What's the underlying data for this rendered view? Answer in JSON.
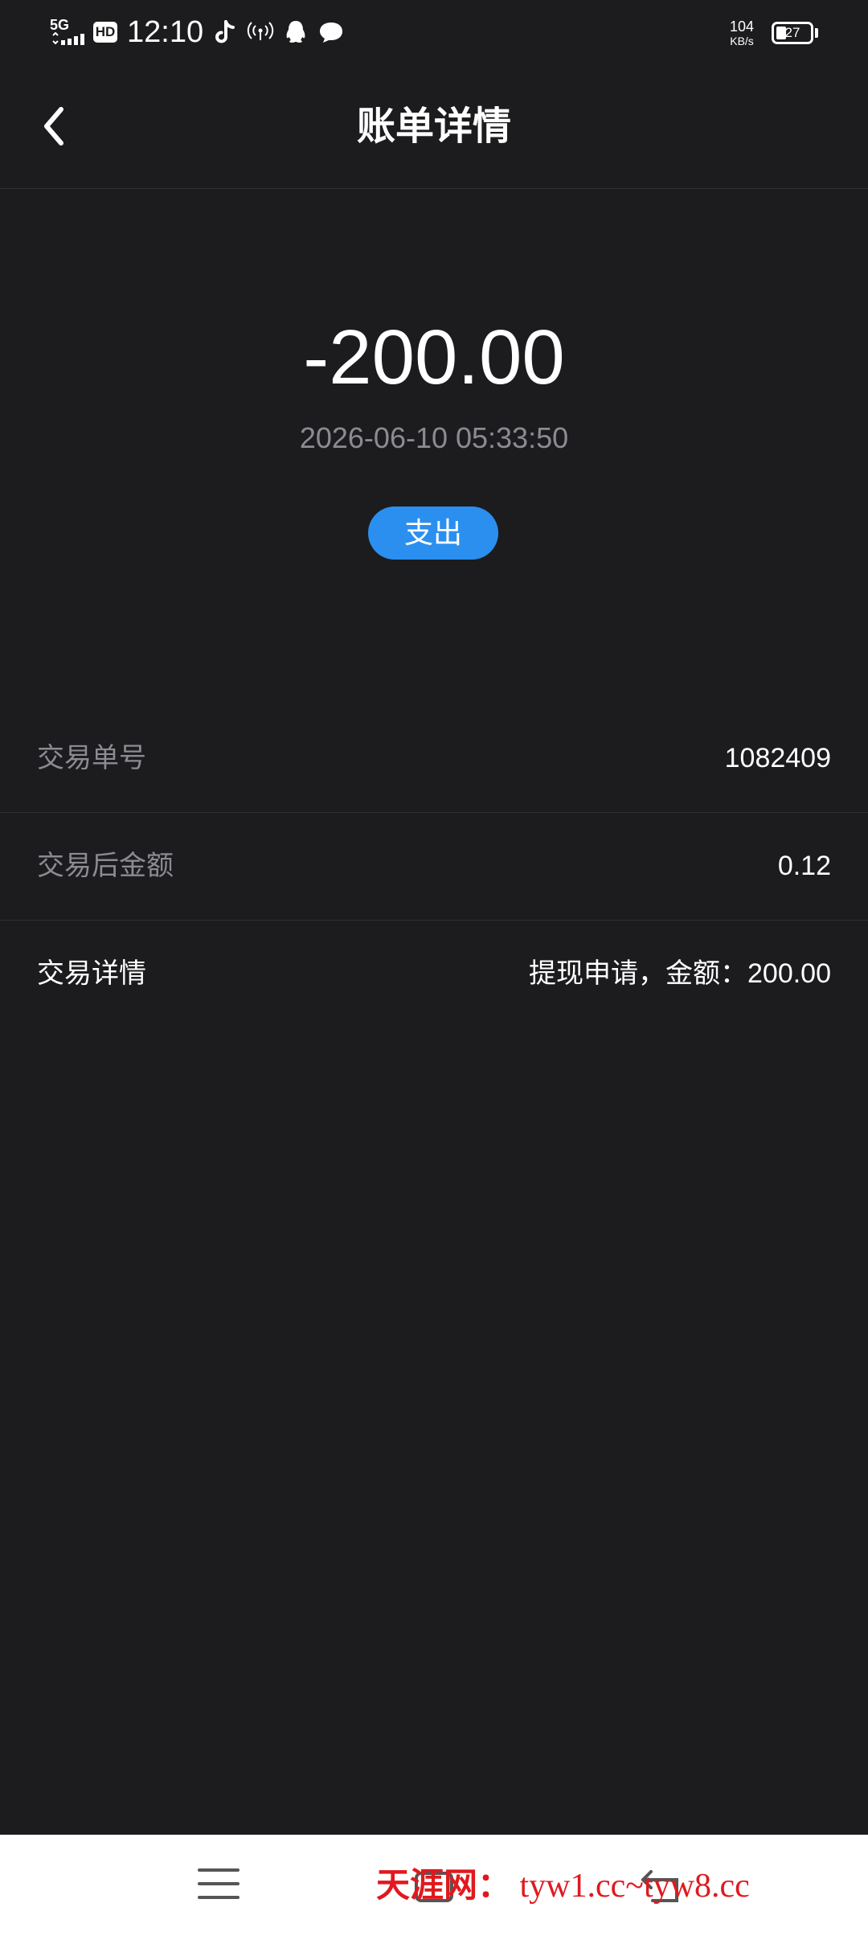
{
  "status_bar": {
    "network": "5G",
    "hd": "HD",
    "time": "12:10",
    "speed_value": "104",
    "speed_unit": "KB/s",
    "battery_level": "27",
    "icons": [
      "tiktok-icon",
      "hotspot-icon",
      "qq-icon",
      "chat-bubble-icon"
    ]
  },
  "header": {
    "title": "账单详情",
    "back_icon": "chevron-left-icon"
  },
  "summary": {
    "amount": "-200.00",
    "datetime": "2026-06-10 05:33:50",
    "type_label": "支出",
    "type_color": "#2b8ff0"
  },
  "details": [
    {
      "label": "交易单号",
      "value": "1082409"
    },
    {
      "label": "交易后金额",
      "value": "0.12"
    },
    {
      "label": "交易详情",
      "value": "提现申请，金额：200.00"
    }
  ],
  "nav_bar": {
    "icons": [
      "menu-icon",
      "home-icon",
      "back-icon"
    ],
    "watermark_cn": "天涯网：",
    "watermark_url": "tyw1.cc~tyw8.cc",
    "watermark_color": "#e0191e"
  }
}
